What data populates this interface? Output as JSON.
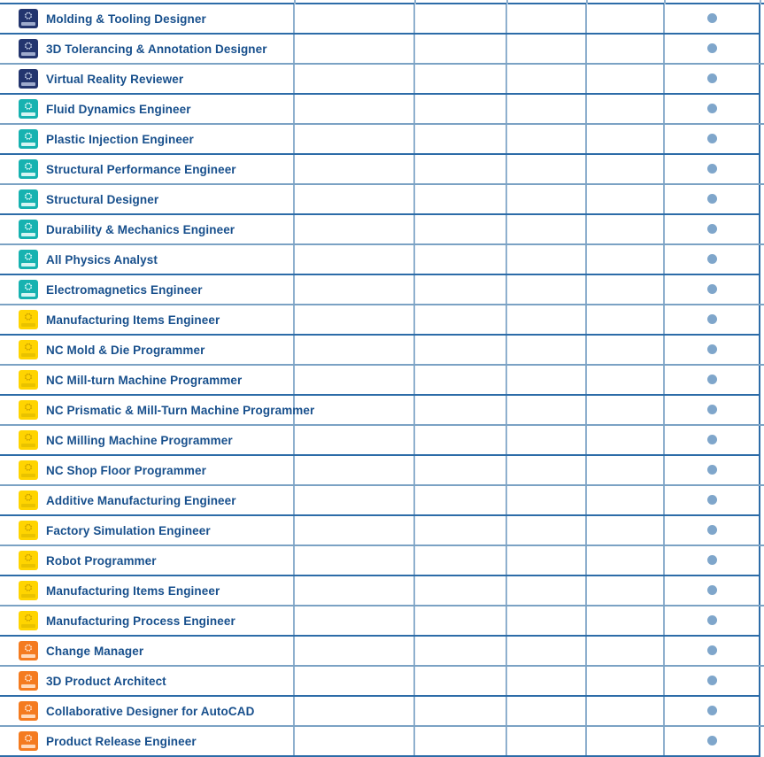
{
  "table": {
    "columns": [
      {
        "key": "name",
        "label": ""
      },
      {
        "key": "col1",
        "label": ""
      },
      {
        "key": "col2",
        "label": ""
      },
      {
        "key": "col3",
        "label": ""
      },
      {
        "key": "col4",
        "label": ""
      },
      {
        "key": "col5",
        "label": ""
      }
    ],
    "colors": {
      "row_border": "#2d6ca8",
      "column_border": "#8fb0ce",
      "text": "#174f8c",
      "dot": "#7fa6cb",
      "icon_dark_blue": "#23356e",
      "icon_teal": "#17b2b0",
      "icon_yellow": "#ffd400",
      "icon_orange": "#f47b20",
      "background": "#ffffff"
    },
    "marker_glyph": "●",
    "rows": [
      {
        "name": "Molding & Tooling Designer",
        "icon": "app-icon-dark-blue",
        "icon_color": "dark",
        "col1": "",
        "col2": "",
        "col3": "",
        "col4": "",
        "col5": "dot"
      },
      {
        "name": "3D Tolerancing & Annotation Designer",
        "icon": "app-icon-dark-blue",
        "icon_color": "dark",
        "col1": "",
        "col2": "",
        "col3": "",
        "col4": "",
        "col5": "dot"
      },
      {
        "name": "Virtual Reality Reviewer",
        "icon": "app-icon-dark-blue",
        "icon_color": "dark",
        "col1": "",
        "col2": "",
        "col3": "",
        "col4": "",
        "col5": "dot"
      },
      {
        "name": "Fluid Dynamics Engineer",
        "icon": "app-icon-teal",
        "icon_color": "teal",
        "col1": "",
        "col2": "",
        "col3": "",
        "col4": "",
        "col5": "dot"
      },
      {
        "name": "Plastic Injection Engineer",
        "icon": "app-icon-teal",
        "icon_color": "teal",
        "col1": "",
        "col2": "",
        "col3": "",
        "col4": "",
        "col5": "dot"
      },
      {
        "name": "Structural Performance Engineer",
        "icon": "app-icon-teal",
        "icon_color": "teal",
        "col1": "",
        "col2": "",
        "col3": "",
        "col4": "",
        "col5": "dot"
      },
      {
        "name": "Structural Designer",
        "icon": "app-icon-teal",
        "icon_color": "teal",
        "col1": "",
        "col2": "",
        "col3": "",
        "col4": "",
        "col5": "dot"
      },
      {
        "name": "Durability & Mechanics Engineer",
        "icon": "app-icon-teal",
        "icon_color": "teal",
        "col1": "",
        "col2": "",
        "col3": "",
        "col4": "",
        "col5": "dot"
      },
      {
        "name": "All Physics Analyst",
        "icon": "app-icon-teal",
        "icon_color": "teal",
        "col1": "",
        "col2": "",
        "col3": "",
        "col4": "",
        "col5": "dot"
      },
      {
        "name": "Electromagnetics Engineer",
        "icon": "app-icon-teal",
        "icon_color": "teal",
        "col1": "",
        "col2": "",
        "col3": "",
        "col4": "",
        "col5": "dot"
      },
      {
        "name": "Manufacturing Items Engineer",
        "icon": "app-icon-yellow",
        "icon_color": "yellow",
        "col1": "",
        "col2": "",
        "col3": "",
        "col4": "",
        "col5": "dot"
      },
      {
        "name": "NC Mold & Die Programmer",
        "icon": "app-icon-yellow",
        "icon_color": "yellow",
        "col1": "",
        "col2": "",
        "col3": "",
        "col4": "",
        "col5": "dot"
      },
      {
        "name": "NC Mill-turn Machine Programmer",
        "icon": "app-icon-yellow",
        "icon_color": "yellow",
        "col1": "",
        "col2": "",
        "col3": "",
        "col4": "",
        "col5": "dot"
      },
      {
        "name": "NC Prismatic & Mill-Turn Machine Programmer",
        "icon": "app-icon-yellow",
        "icon_color": "yellow",
        "col1": "",
        "col2": "",
        "col3": "",
        "col4": "",
        "col5": "dot"
      },
      {
        "name": "NC Milling Machine Programmer",
        "icon": "app-icon-yellow",
        "icon_color": "yellow",
        "col1": "",
        "col2": "",
        "col3": "",
        "col4": "",
        "col5": "dot"
      },
      {
        "name": "NC Shop Floor Programmer",
        "icon": "app-icon-yellow",
        "icon_color": "yellow",
        "col1": "",
        "col2": "",
        "col3": "",
        "col4": "",
        "col5": "dot"
      },
      {
        "name": "Additive Manufacturing Engineer",
        "icon": "app-icon-yellow",
        "icon_color": "yellow",
        "col1": "",
        "col2": "",
        "col3": "",
        "col4": "",
        "col5": "dot"
      },
      {
        "name": "Factory Simulation Engineer",
        "icon": "app-icon-yellow",
        "icon_color": "yellow",
        "col1": "",
        "col2": "",
        "col3": "",
        "col4": "",
        "col5": "dot"
      },
      {
        "name": "Robot Programmer",
        "icon": "app-icon-yellow",
        "icon_color": "yellow",
        "col1": "",
        "col2": "",
        "col3": "",
        "col4": "",
        "col5": "dot"
      },
      {
        "name": "Manufacturing Items Engineer",
        "icon": "app-icon-yellow",
        "icon_color": "yellow",
        "col1": "",
        "col2": "",
        "col3": "",
        "col4": "",
        "col5": "dot"
      },
      {
        "name": "Manufacturing Process Engineer",
        "icon": "app-icon-yellow",
        "icon_color": "yellow",
        "col1": "",
        "col2": "",
        "col3": "",
        "col4": "",
        "col5": "dot"
      },
      {
        "name": "Change Manager",
        "icon": "app-icon-orange",
        "icon_color": "orange",
        "col1": "",
        "col2": "",
        "col3": "",
        "col4": "",
        "col5": "dot"
      },
      {
        "name": "3D Product Architect",
        "icon": "app-icon-orange",
        "icon_color": "orange",
        "col1": "",
        "col2": "",
        "col3": "",
        "col4": "",
        "col5": "dot"
      },
      {
        "name": "Collaborative Designer for AutoCAD",
        "icon": "app-icon-orange",
        "icon_color": "orange",
        "col1": "",
        "col2": "",
        "col3": "",
        "col4": "",
        "col5": "dot"
      },
      {
        "name": "Product Release Engineer",
        "icon": "app-icon-orange",
        "icon_color": "orange",
        "col1": "",
        "col2": "",
        "col3": "",
        "col4": "",
        "col5": "dot"
      }
    ]
  }
}
